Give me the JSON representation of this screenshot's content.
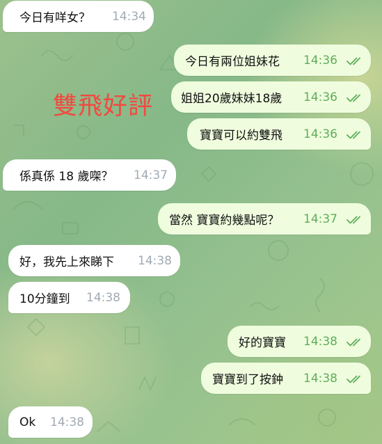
{
  "chat": {
    "overlay_caption": "雙飛好評",
    "messages": [
      {
        "text": "今日有咩女？",
        "time": "14:34"
      },
      {
        "text": "今日有兩位姐妹花",
        "time": "14:36"
      },
      {
        "text": "姐姐20歲妹妹18歲",
        "time": "14:36"
      },
      {
        "text": "寶寶可以約雙飛",
        "time": "14:36"
      },
      {
        "text": "係真係 18 歲㗎？",
        "time": "14:37"
      },
      {
        "text": "當然 寶寶約幾點呢？",
        "time": "14:37"
      },
      {
        "text": "好，我先上來睇下",
        "time": "14:38"
      },
      {
        "text": "10分鐘到",
        "time": "14:38"
      },
      {
        "text": "好的寶寶",
        "time": "14:38"
      },
      {
        "text": "寶寶到了按鈡",
        "time": "14:38"
      },
      {
        "text": "Ok",
        "time": "14:38"
      }
    ]
  },
  "colors": {
    "incoming_bubble": "#ffffff",
    "outgoing_bubble": "#effdde",
    "read_check": "#5fad5a",
    "overlay_text": "#f2493f"
  },
  "icons": {
    "read_receipt": "double-check-icon"
  }
}
